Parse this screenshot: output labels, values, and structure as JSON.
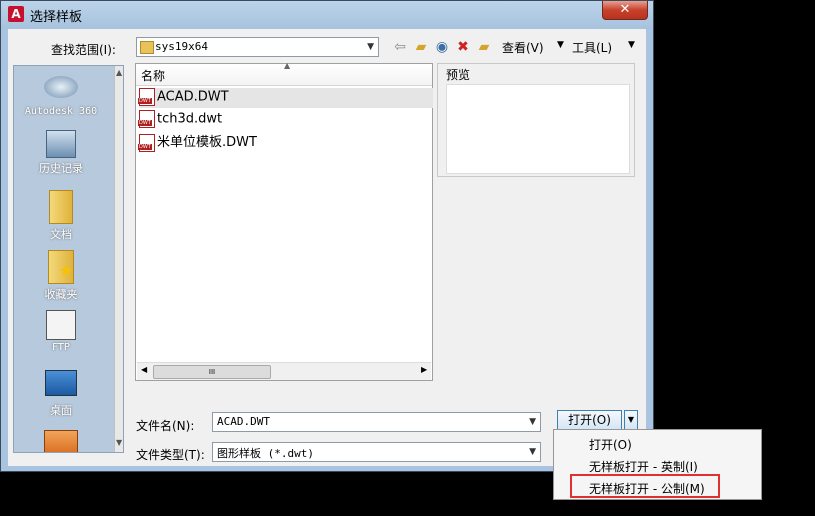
{
  "window": {
    "title": "选择样板",
    "close_glyph": "✕"
  },
  "toolbar": {
    "look_in_label": "查找范围(I):",
    "look_in_value": "sys19x64",
    "views_label": "查看(V)",
    "tools_label": "工具(L)"
  },
  "places": [
    {
      "label": "Autodesk 360",
      "icon": "cloud-icon"
    },
    {
      "label": "历史记录",
      "icon": "history-icon"
    },
    {
      "label": "文档",
      "icon": "documents-folder-icon"
    },
    {
      "label": "收藏夹",
      "icon": "favorites-folder-icon"
    },
    {
      "label": "FTP",
      "icon": "ftp-icon"
    },
    {
      "label": "桌面",
      "icon": "desktop-icon"
    }
  ],
  "file_list": {
    "column_name": "名称",
    "files": [
      {
        "name": "ACAD.DWT",
        "selected": true
      },
      {
        "name": "tch3d.dwt",
        "selected": false
      },
      {
        "name": "米单位模板.DWT",
        "selected": false
      }
    ],
    "scroll_glyph": "III"
  },
  "preview": {
    "label": "预览"
  },
  "filename": {
    "label": "文件名(N):",
    "value": "ACAD.DWT"
  },
  "filetype": {
    "label": "文件类型(T):",
    "value": "图形样板 (*.dwt)"
  },
  "open_button": {
    "label": "打开(O)"
  },
  "open_menu": {
    "items": [
      "打开(O)",
      "无样板打开 - 英制(I)",
      "无样板打开 - 公制(M)"
    ],
    "highlight_color": "#e03030"
  }
}
